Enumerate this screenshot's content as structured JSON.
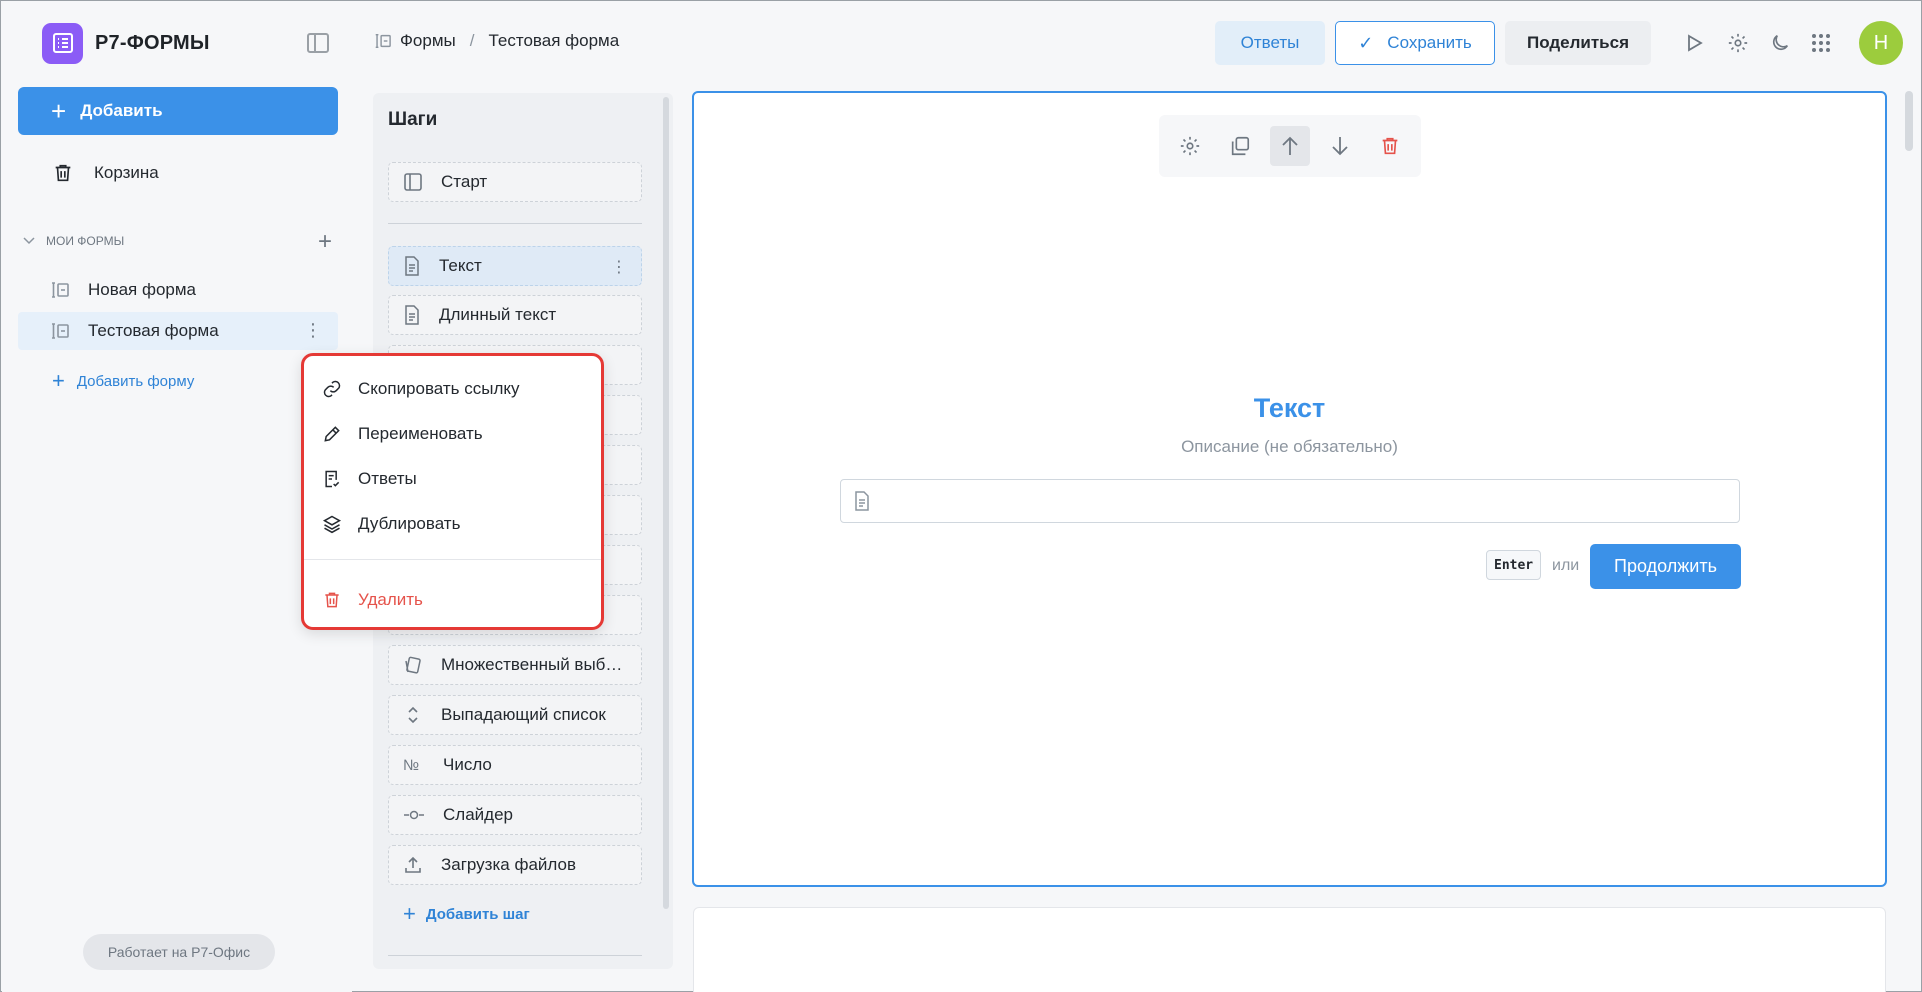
{
  "app": {
    "name": "Р7-ФОРМЫ"
  },
  "sidebar": {
    "add_label": "Добавить",
    "trash_label": "Корзина",
    "section_label": "МОИ ФОРМЫ",
    "forms": [
      {
        "label": "Новая форма"
      },
      {
        "label": "Тестовая форма"
      }
    ],
    "add_form_label": "Добавить форму",
    "powered_by": "Работает на Р7-Офис"
  },
  "header": {
    "breadcrumb_root": "Формы",
    "breadcrumb_sep": "/",
    "breadcrumb_current": "Тестовая форма",
    "answers_label": "Ответы",
    "save_label": "Сохранить",
    "share_label": "Поделиться",
    "avatar_initial": "Н"
  },
  "steps": {
    "title": "Шаги",
    "start_label": "Старт",
    "items": [
      {
        "label": "Текст",
        "icon": "document-icon"
      },
      {
        "label": "Длинный текст",
        "icon": "document-icon"
      },
      {
        "label": "Множественный выб…",
        "icon": "cards-icon"
      },
      {
        "label": "Выпадающий список",
        "icon": "updown-icon"
      },
      {
        "label": "Число",
        "icon": "numero-icon"
      },
      {
        "label": "Слайдер",
        "icon": "slider-icon"
      },
      {
        "label": "Загрузка файлов",
        "icon": "upload-icon"
      }
    ],
    "add_step_label": "Добавить шаг"
  },
  "question": {
    "title": "Текст",
    "description": "Описание (не обязательно)",
    "enter_key": "Enter",
    "or_text": "или",
    "continue_label": "Продолжить"
  },
  "context_menu": {
    "items": [
      {
        "label": "Скопировать ссылку"
      },
      {
        "label": "Переименовать"
      },
      {
        "label": "Ответы"
      },
      {
        "label": "Дублировать"
      }
    ],
    "delete_label": "Удалить"
  },
  "colors": {
    "accent": "#3b91e8",
    "logo": "#8b5cf6",
    "danger": "#e53935",
    "avatar": "#9ccc3d"
  }
}
